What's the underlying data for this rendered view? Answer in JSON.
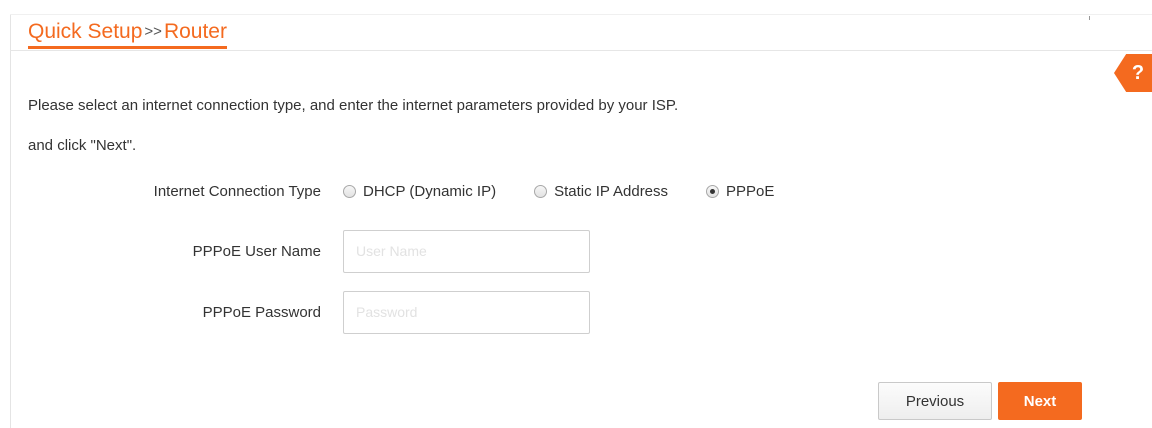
{
  "header": {
    "breadcrumb_root": "Quick Setup",
    "breadcrumb_sep": ">>",
    "breadcrumb_current": "Router",
    "help_label": "?"
  },
  "instructions": {
    "line1": "Please select an internet connection type, and enter the internet parameters provided by your ISP.",
    "line2": "and click \"Next\"."
  },
  "connection": {
    "label": "Internet Connection Type",
    "options": [
      {
        "label": "DHCP (Dynamic IP)",
        "selected": false
      },
      {
        "label": "Static IP Address",
        "selected": false
      },
      {
        "label": "PPPoE",
        "selected": true
      }
    ]
  },
  "pppoe": {
    "user_label": "PPPoE User Name",
    "user_value": "",
    "user_placeholder": "User Name",
    "pass_label": "PPPoE Password",
    "pass_value": "",
    "pass_placeholder": "Password"
  },
  "buttons": {
    "previous": "Previous",
    "next": "Next"
  },
  "colors": {
    "accent": "#f46a1f",
    "text": "#333333",
    "border": "#cfcfcf"
  }
}
